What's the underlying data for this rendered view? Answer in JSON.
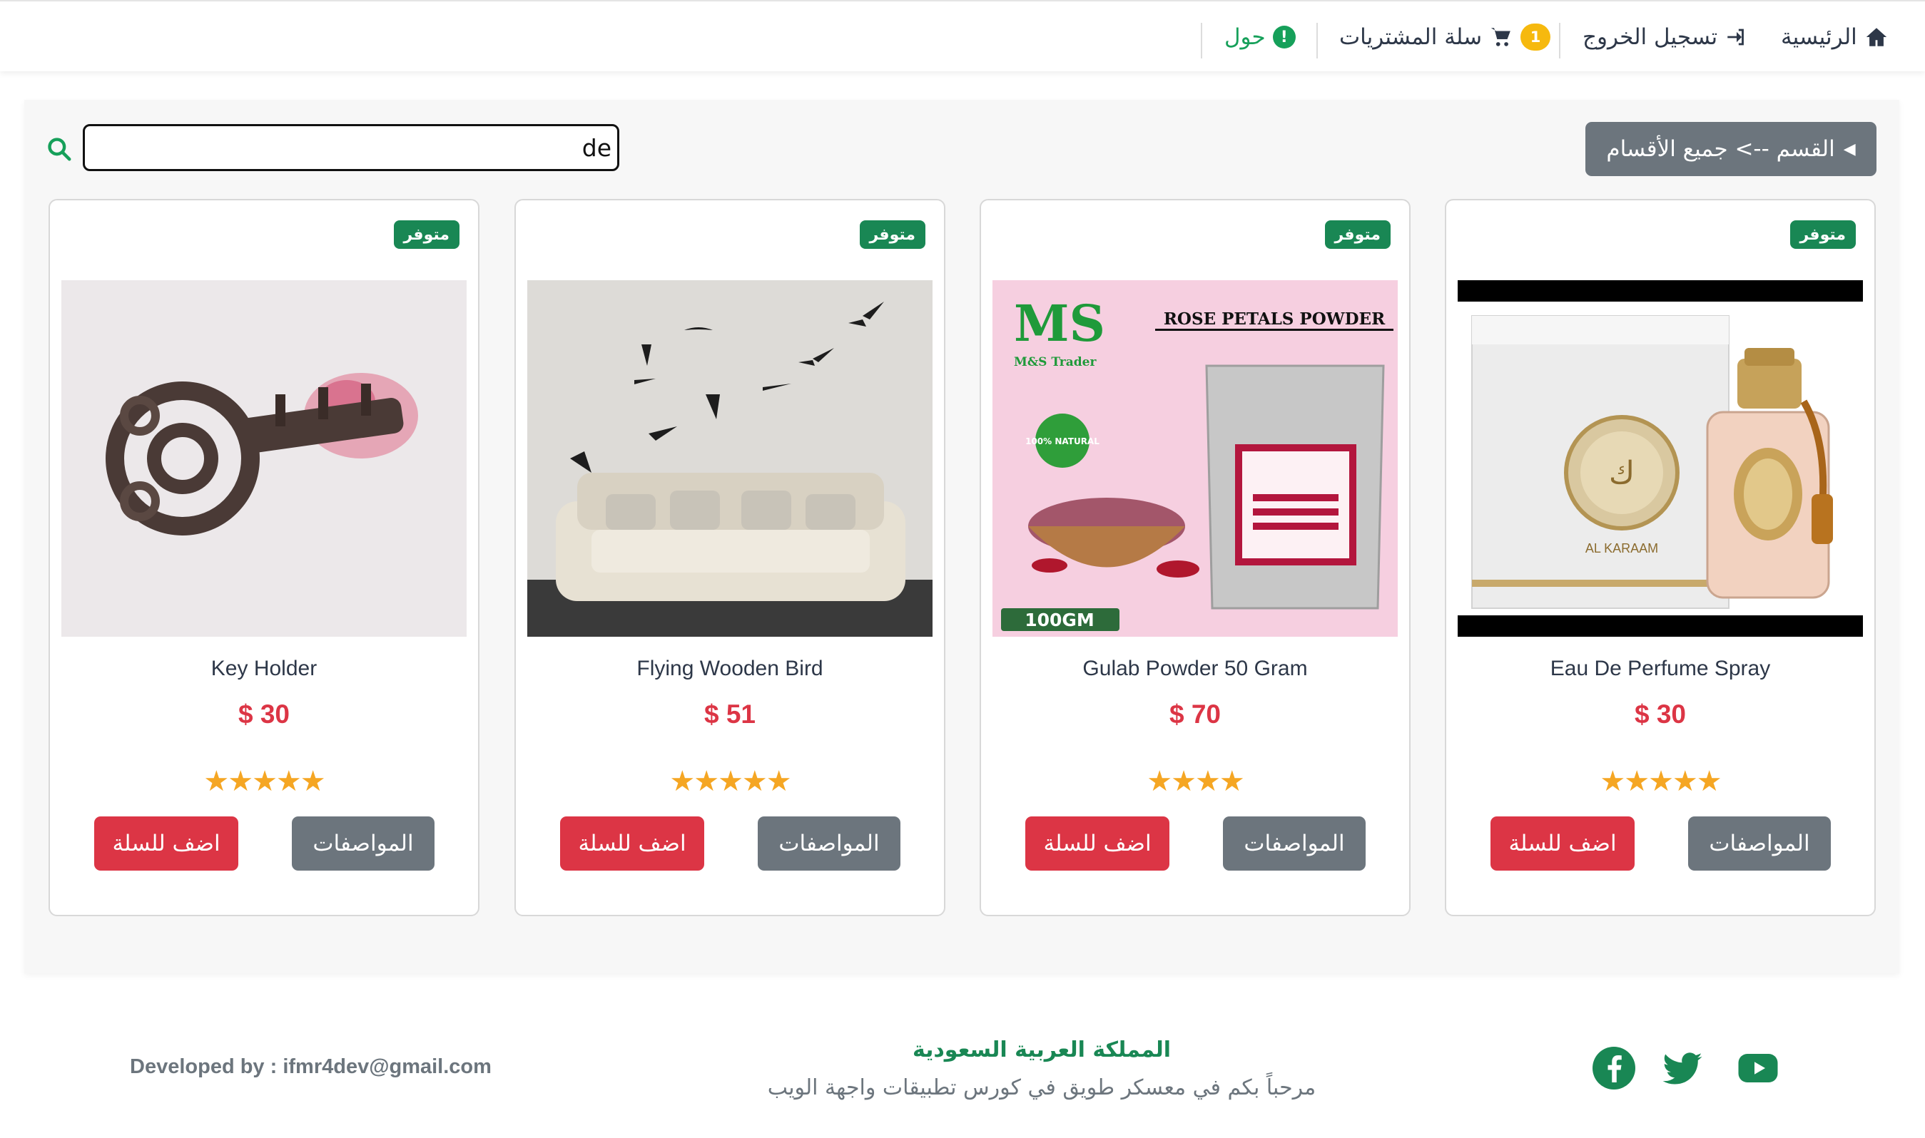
{
  "nav": {
    "home": "الرئيسية",
    "logout": "تسجيل الخروج",
    "cart": "سلة المشتريات",
    "cart_count": "1",
    "about": "حول",
    "about_icon": "!"
  },
  "toolbar": {
    "category_label": "القسم --> جميع الأقسام",
    "search_value": "de"
  },
  "products": [
    {
      "name": "Eau De Perfume Spray",
      "price": "$ 30",
      "stock": "متوفر",
      "rating": "★★★★★",
      "specs": "المواصفات",
      "add": "اضف للسلة",
      "image": "perfume-bottle"
    },
    {
      "name": "Gulab Powder 50 Gram",
      "price": "$ 70",
      "stock": "متوفر",
      "rating": "★★★★",
      "specs": "المواصفات",
      "add": "اضف للسلة",
      "image": "rose-petals-powder"
    },
    {
      "name": "Flying Wooden Bird",
      "price": "$ 51",
      "stock": "متوفر",
      "rating": "★★★★★",
      "specs": "المواصفات",
      "add": "اضف للسلة",
      "image": "sofa-with-birds"
    },
    {
      "name": "Key Holder",
      "price": "$ 30",
      "stock": "متوفر",
      "rating": "★★★★★",
      "specs": "المواصفات",
      "add": "اضف للسلة",
      "image": "key-holder"
    }
  ],
  "product_images": {
    "rose_header": "ROSE PETALS POWDER",
    "rose_brand": "M&S Trader",
    "rose_weight": "100GM",
    "rose_natural": "100% NATURAL",
    "perfume_brand": "AL KARAAM"
  },
  "footer": {
    "developer": "Developed by : ifmr4dev@gmail.com",
    "country": "المملكة العربية السعودية",
    "welcome": "مرحباً بكم في معسكر طويق في كورس تطبيقات واجهة الويب"
  },
  "colors": {
    "accent_green": "#198754",
    "danger_red": "#dc3545",
    "secondary_gray": "#6c757d",
    "badge_yellow": "#f6b90e",
    "star_orange": "#f5a623"
  }
}
